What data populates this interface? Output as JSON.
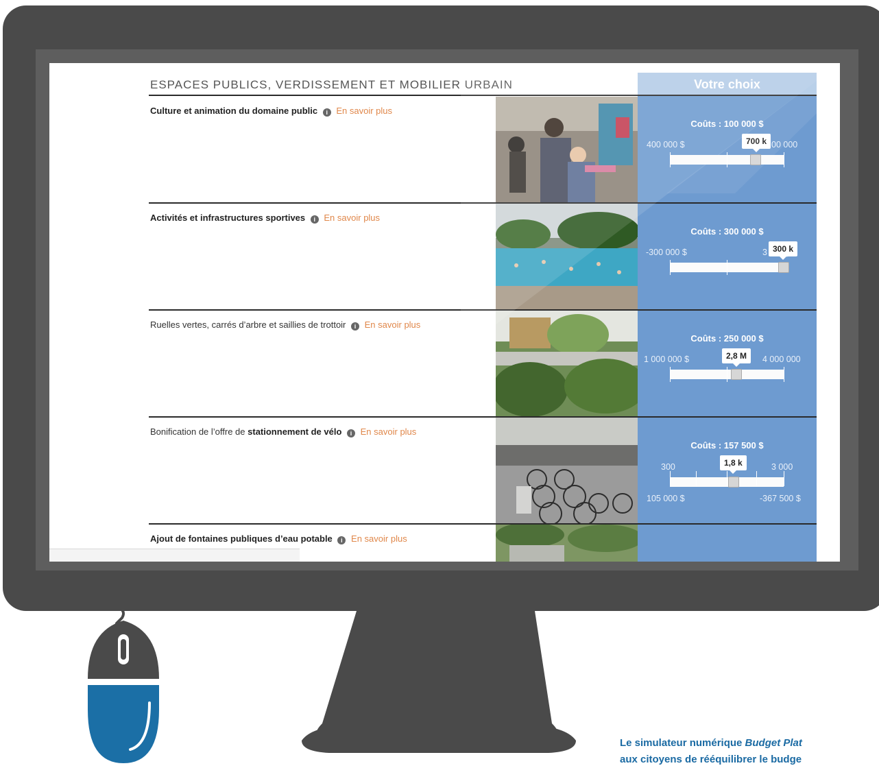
{
  "section_title": "ESPACES PUBLICS, VERDISSEMENT ET MOBILIER URBAIN",
  "choice_header": "Votre choix",
  "more_link": "En savoir plus",
  "info_glyph": "i",
  "rows": [
    {
      "title_bold": "Culture et animation du domaine public",
      "title_normal": "",
      "costs": "Coûts : 100 000 $",
      "left_label": "400 000 $",
      "right_label": "00 000",
      "value": "700 k",
      "slider_level": 0.75
    },
    {
      "title_bold": "Activités et infrastructures sportives",
      "title_normal": "",
      "costs": "Coûts : 300 000 $",
      "left_label": "-300 000 $",
      "right_label": "3",
      "right_label_tail": ")",
      "value": "300 k",
      "slider_level": 1.0
    },
    {
      "title_bold": "",
      "title_normal": "Ruelles vertes, carrés d’arbre et saillies de trottoir",
      "costs": "Coûts : 250 000 $",
      "left_label": "1 000 000 $",
      "right_label": "4 000 000",
      "value": "2,8 M",
      "slider_level": 0.58
    },
    {
      "title_pre": "Bonification de l’offre de ",
      "title_bold": "stationnement de vélo",
      "costs": "Coûts : 157 500 $",
      "left_label": "300",
      "right_label": "3 000",
      "value": "1,8 k",
      "slider_level": 0.55,
      "bottom_left": "105 000 $",
      "bottom_right": "-367 500 $"
    },
    {
      "title_bold": "Ajout de fontaines publiques d’eau potable"
    }
  ],
  "caption": {
    "line1_prefix": "Le simulateur numérique ",
    "line1_italic": "Budget Plat",
    "line2": "aux citoyens de rééquilibrer le budge"
  },
  "icons": [
    "info-icon",
    "mouse-icon"
  ],
  "colors": {
    "choice_column": "#6e9bd0",
    "link": "#e0874a",
    "bezel": "#4a4a4a",
    "caption": "#1a6aa3"
  }
}
